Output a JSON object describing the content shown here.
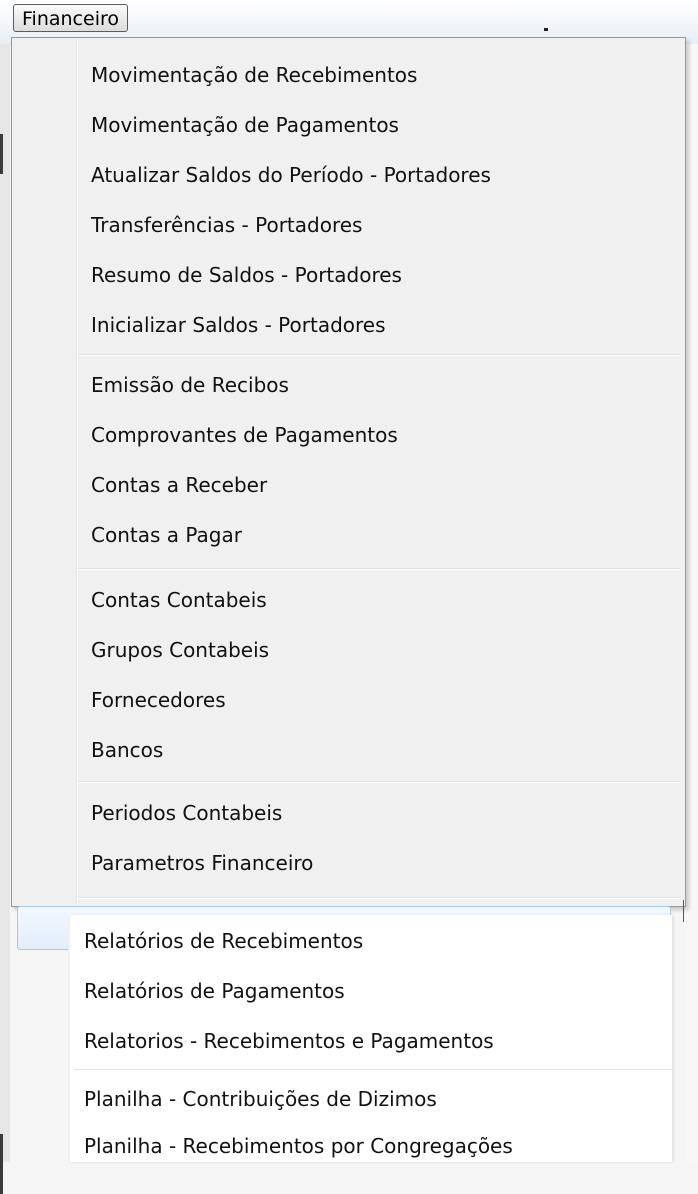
{
  "menubar": {
    "menu_title": "Financeiro"
  },
  "dropdown": {
    "groups": [
      {
        "items": [
          {
            "label": "Movimentação de Recebimentos"
          },
          {
            "label": "Movimentação de Pagamentos"
          },
          {
            "label": "Atualizar Saldos do Período - Portadores"
          },
          {
            "label": "Transferências - Portadores"
          },
          {
            "label": "Resumo de Saldos - Portadores"
          },
          {
            "label": "Inicializar Saldos - Portadores"
          }
        ]
      },
      {
        "items": [
          {
            "label": "Emissão de Recibos"
          },
          {
            "label": "Comprovantes de Pagamentos"
          },
          {
            "label": "Contas a Receber"
          },
          {
            "label": "Contas a Pagar"
          }
        ]
      },
      {
        "items": [
          {
            "label": "Contas Contabeis"
          },
          {
            "label": "Grupos Contabeis"
          },
          {
            "label": "Fornecedores"
          },
          {
            "label": "Bancos"
          }
        ]
      },
      {
        "items": [
          {
            "label": "Periodos Contabeis"
          },
          {
            "label": "Parametros Financeiro"
          }
        ]
      }
    ]
  },
  "submenu": {
    "groups": [
      {
        "items": [
          {
            "label": "Relatórios de Recebimentos"
          },
          {
            "label": "Relatórios de Pagamentos"
          },
          {
            "label": "Relatorios - Recebimentos e Pagamentos"
          }
        ]
      },
      {
        "items": [
          {
            "label": "Planilha  - Contribuições de Dizimos"
          },
          {
            "label": "Planilha - Recebimentos por Congregações"
          }
        ]
      }
    ]
  }
}
